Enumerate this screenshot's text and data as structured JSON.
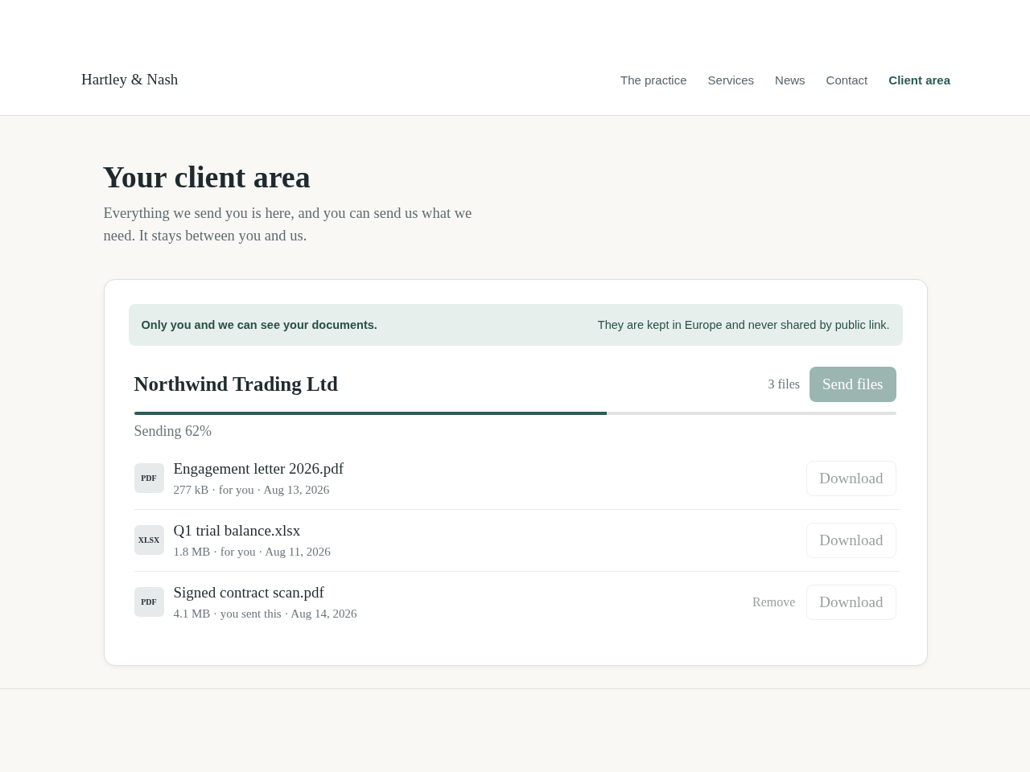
{
  "header": {
    "logo": "Hartley & Nash",
    "nav": [
      {
        "label": "The practice",
        "selected": false
      },
      {
        "label": "Services",
        "selected": false
      },
      {
        "label": "News",
        "selected": false
      },
      {
        "label": "Contact",
        "selected": false
      },
      {
        "label": "Client area",
        "selected": true
      }
    ]
  },
  "intro": {
    "title": "Your client area",
    "lede": "Everything we send you is here, and you can send us what we need. It stays between you and us."
  },
  "notice": {
    "primary": "Only you and we can see your documents.",
    "secondary": "They are kept in Europe and never shared by public link."
  },
  "client": {
    "name": "Northwind Trading Ltd",
    "file_count": "3 files",
    "send_button": {
      "label": "Send files",
      "disabled": true
    }
  },
  "upload": {
    "level": 0.62,
    "status": "Sending 62%"
  },
  "files": [
    {
      "type_label": "PDF",
      "name": "Engagement letter 2026.pdf",
      "meta": "277 kB · for you · Aug 13, 2026",
      "download": {
        "label": "Download",
        "disabled": true
      }
    },
    {
      "type_label": "XLSX",
      "name": "Q1 trial balance.xlsx",
      "meta": "1.8 MB · for you · Aug 11, 2026",
      "download": {
        "label": "Download",
        "disabled": true
      }
    },
    {
      "type_label": "PDF",
      "name": "Signed contract scan.pdf",
      "meta": "4.1 MB · you sent this · Aug 14, 2026",
      "remove": {
        "label": "Remove",
        "disabled": true
      },
      "download": {
        "label": "Download",
        "disabled": true
      }
    }
  ]
}
